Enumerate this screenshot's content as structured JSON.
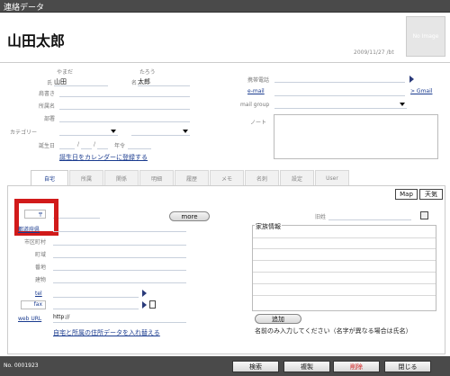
{
  "window": {
    "title": "連絡データ"
  },
  "header": {
    "full_name": "山田太郎",
    "image_placeholder": "No Image",
    "date": "2009/11/27 /bt"
  },
  "name": {
    "sei_kana": "やまだ",
    "mei_kana": "たろう",
    "sei_label": "氏",
    "sei": "山田",
    "mei_label": "名",
    "mei": "太郎"
  },
  "labels": {
    "katagaki": "肩書き",
    "shozoku": "所属名",
    "busho": "部署",
    "category": "カテゴリー",
    "birthday": "誕生日",
    "age": "年令",
    "mobile": "携帯電話",
    "email": "e-mail",
    "gmail": "> Gmail",
    "mail_group": "mail group",
    "note": "ノート"
  },
  "birthday": {
    "sep1": "/",
    "sep2": "/",
    "register_calendar": "誕生日をカレンダーに登録する"
  },
  "tabs": [
    {
      "label": "自宅"
    },
    {
      "label": "所属"
    },
    {
      "label": "関係"
    },
    {
      "label": "明細"
    },
    {
      "label": "履歴"
    },
    {
      "label": "メモ"
    },
    {
      "label": "名刺"
    },
    {
      "label": "設定"
    },
    {
      "label": "User"
    }
  ],
  "view_buttons": {
    "map": "Map",
    "weather": "天気"
  },
  "address": {
    "zip_mark": "〒",
    "more": "more",
    "old_address": "旧姓",
    "prefecture": "都道府県",
    "city": "市区町村",
    "town": "町域",
    "banchi": "番地",
    "building": "建物",
    "tel": "tel",
    "fax": "fax",
    "web_url": "web URL",
    "web_url_value": "http://",
    "swap_link": "自宅と所属の住所データを入れ替える"
  },
  "family": {
    "title": "家族情報",
    "add_button": "追加",
    "hint": "名前のみ入力してください（名字が異なる場合は氏名）"
  },
  "footer": {
    "record_no": "No. 0001923",
    "search": "検索",
    "duplicate": "複製",
    "delete": "削除",
    "close": "閉じる"
  },
  "colors": {
    "highlight_box": "#d11a1a",
    "delete_text": "#d11a1a",
    "link": "#1a3b8f",
    "titlebar": "#4a4a4a"
  }
}
